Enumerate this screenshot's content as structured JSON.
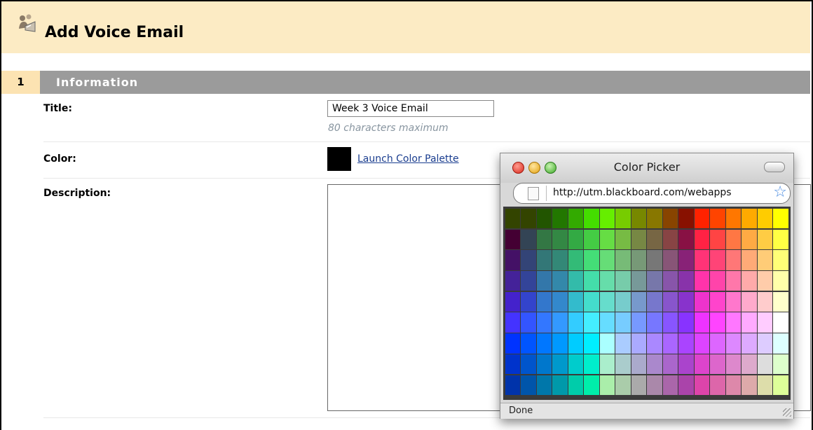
{
  "page": {
    "title": "Add Voice Email"
  },
  "section": {
    "number": "1",
    "title": "Information"
  },
  "form": {
    "title_label": "Title:",
    "title_value": "Week 3 Voice Email",
    "title_hint": "80 characters maximum",
    "color_label": "Color:",
    "color_value": "#000000",
    "launch_palette": "Launch Color Palette",
    "description_label": "Description:",
    "description_value": ""
  },
  "popup": {
    "title": "Color Picker",
    "url": "http://utm.blackboard.com/webapps",
    "status": "Done",
    "colors": [
      [
        "#334400",
        "#334400",
        "#225500",
        "#227700",
        "#33aa00",
        "#44dd00",
        "#66ee00",
        "#77cc00",
        "#778800",
        "#887700",
        "#884400",
        "#881100",
        "#ff2200",
        "#ff4400",
        "#ff7700",
        "#ffaa00",
        "#ffcc00",
        "#ffff00"
      ],
      [
        "#440033",
        "#334455",
        "#337744",
        "#338844",
        "#33aa44",
        "#44cc44",
        "#66dd44",
        "#77bb44",
        "#778844",
        "#776644",
        "#884444",
        "#881144",
        "#ff2244",
        "#ff4444",
        "#ff7744",
        "#ffaa44",
        "#ffcc44",
        "#ffff44"
      ],
      [
        "#441166",
        "#334477",
        "#337777",
        "#338877",
        "#33bb77",
        "#44dd77",
        "#66dd77",
        "#77bb77",
        "#779977",
        "#777777",
        "#885577",
        "#882277",
        "#ff3377",
        "#ff4477",
        "#ff7777",
        "#ffaa77",
        "#ffcc77",
        "#ffff77"
      ],
      [
        "#442299",
        "#334499",
        "#3377aa",
        "#3388aa",
        "#33bbaa",
        "#44ddaa",
        "#66ddaa",
        "#77ccaa",
        "#779999",
        "#7777aa",
        "#8855aa",
        "#8833aa",
        "#ff33aa",
        "#ff44aa",
        "#ff77aa",
        "#ffaaaa",
        "#ffccaa",
        "#ffffaa"
      ],
      [
        "#4422cc",
        "#3344cc",
        "#3377cc",
        "#3388cc",
        "#33bbcc",
        "#44ddcc",
        "#66ddcc",
        "#77cccc",
        "#7799cc",
        "#7777cc",
        "#8855cc",
        "#8833cc",
        "#ee33cc",
        "#ff44cc",
        "#ff77cc",
        "#ffaacc",
        "#ffcccc",
        "#ffffcc"
      ],
      [
        "#4433ff",
        "#3355ff",
        "#3377ff",
        "#3399ff",
        "#33ccff",
        "#44eeff",
        "#66ddff",
        "#77ccff",
        "#7799ff",
        "#7777ff",
        "#8855ff",
        "#8833ff",
        "#ee33ff",
        "#ff44ff",
        "#ff77ff",
        "#ffaaff",
        "#ffccff",
        "#ffffff"
      ],
      [
        "#0033ff",
        "#0055ff",
        "#0077ff",
        "#0099ff",
        "#00ccff",
        "#00eeff",
        "#aaffff",
        "#aaccff",
        "#aaaaff",
        "#aa88ff",
        "#aa66ff",
        "#aa44ff",
        "#dd44ff",
        "#dd66ff",
        "#dd88ff",
        "#ddaaff",
        "#ddccff",
        "#ddffff"
      ],
      [
        "#0033cc",
        "#0055cc",
        "#0077cc",
        "#0099cc",
        "#00cccc",
        "#00eecc",
        "#aaeecc",
        "#aacccc",
        "#aaaacc",
        "#aa88cc",
        "#aa66cc",
        "#aa44cc",
        "#dd44cc",
        "#dd66cc",
        "#dd88cc",
        "#ddaacc",
        "#dddddd",
        "#ddffcc"
      ],
      [
        "#0033aa",
        "#0055aa",
        "#0077aa",
        "#0099aa",
        "#00ccaa",
        "#00eeaa",
        "#aaeeaa",
        "#aaccaa",
        "#aaaaaa",
        "#aa88aa",
        "#aa66aa",
        "#aa44aa",
        "#dd44aa",
        "#dd66aa",
        "#dd88aa",
        "#ddaaaa",
        "#ddddaa",
        "#ddff99"
      ]
    ]
  }
}
